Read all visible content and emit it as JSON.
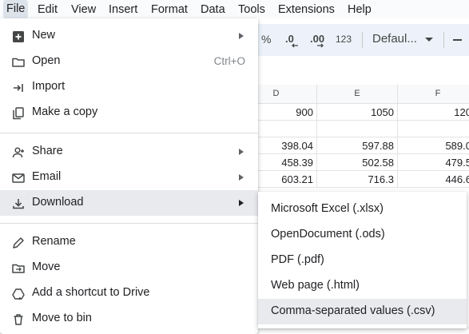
{
  "menubar": {
    "items": [
      "File",
      "Edit",
      "View",
      "Insert",
      "Format",
      "Data",
      "Tools",
      "Extensions",
      "Help"
    ]
  },
  "toolbar": {
    "percent": "%",
    "decrease_decimal": ".0",
    "increase_decimal": ".00",
    "number_format": "123",
    "font": "Defaul..."
  },
  "grid": {
    "columns": [
      "D",
      "E",
      "F"
    ],
    "rows": [
      [
        "900",
        "1050",
        "120"
      ],
      [
        "",
        "",
        ""
      ],
      [
        "398.04",
        "597.88",
        "589.0"
      ],
      [
        "458.39",
        "502.58",
        "479.5"
      ],
      [
        "603.21",
        "716.3",
        "446.6"
      ]
    ]
  },
  "file_menu": {
    "items": [
      {
        "label": "New",
        "icon": "plus-square-icon",
        "submenu": true
      },
      {
        "label": "Open",
        "icon": "folder-icon",
        "shortcut": "Ctrl+O"
      },
      {
        "label": "Import",
        "icon": "import-icon"
      },
      {
        "label": "Make a copy",
        "icon": "copy-icon"
      },
      {
        "label": "Share",
        "icon": "share-person-icon",
        "submenu": true
      },
      {
        "label": "Email",
        "icon": "email-icon",
        "submenu": true
      },
      {
        "label": "Download",
        "icon": "download-icon",
        "submenu": true,
        "highlighted": true
      },
      {
        "label": "Rename",
        "icon": "pencil-icon"
      },
      {
        "label": "Move",
        "icon": "move-folder-icon"
      },
      {
        "label": "Add a shortcut to Drive",
        "icon": "drive-shortcut-icon"
      },
      {
        "label": "Move to bin",
        "icon": "trash-icon"
      }
    ]
  },
  "download_menu": {
    "items": [
      {
        "label": "Microsoft Excel (.xlsx)"
      },
      {
        "label": "OpenDocument (.ods)"
      },
      {
        "label": "PDF (.pdf)"
      },
      {
        "label": "Web page (.html)"
      },
      {
        "label": "Comma-separated values (.csv)",
        "highlighted": true
      }
    ]
  },
  "colors": {
    "menu_highlight": "#e8eaed",
    "toolbar_bg": "#edf2fa",
    "active_menu_bg": "#dde3ea"
  }
}
